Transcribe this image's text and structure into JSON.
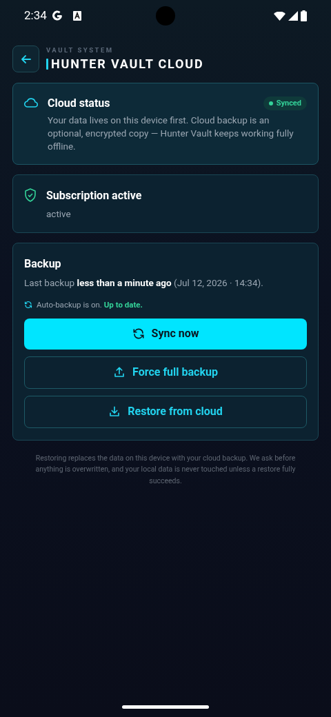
{
  "status_bar": {
    "time": "2:34"
  },
  "header": {
    "eyebrow": "VAULT SYSTEM",
    "title": "HUNTER VAULT CLOUD"
  },
  "cloud_status": {
    "title": "Cloud status",
    "badge": {
      "label": "Synced",
      "color": "#34d399"
    },
    "description": "Your data lives on this device first. Cloud backup is an optional, encrypted copy — Hunter Vault keeps working fully offline."
  },
  "subscription": {
    "title": "Subscription active",
    "state": "active"
  },
  "backup": {
    "title": "Backup",
    "last_backup": "Last backup **less than a minute ago** (Jul 12, 2026 · 14:34).",
    "auto_backup": "Auto-backup is on.",
    "auto_state": "Up to date.",
    "buttons": [
      {
        "label": "Sync now",
        "kind": "primary"
      },
      {
        "label": "Force full backup",
        "kind": "outline"
      },
      {
        "label": "Restore from cloud",
        "kind": "outline"
      }
    ]
  },
  "footnote": "Restoring replaces the data on this device with your cloud backup. We ask before anything is overwritten, and your local data is never touched unless a restore fully succeeds."
}
